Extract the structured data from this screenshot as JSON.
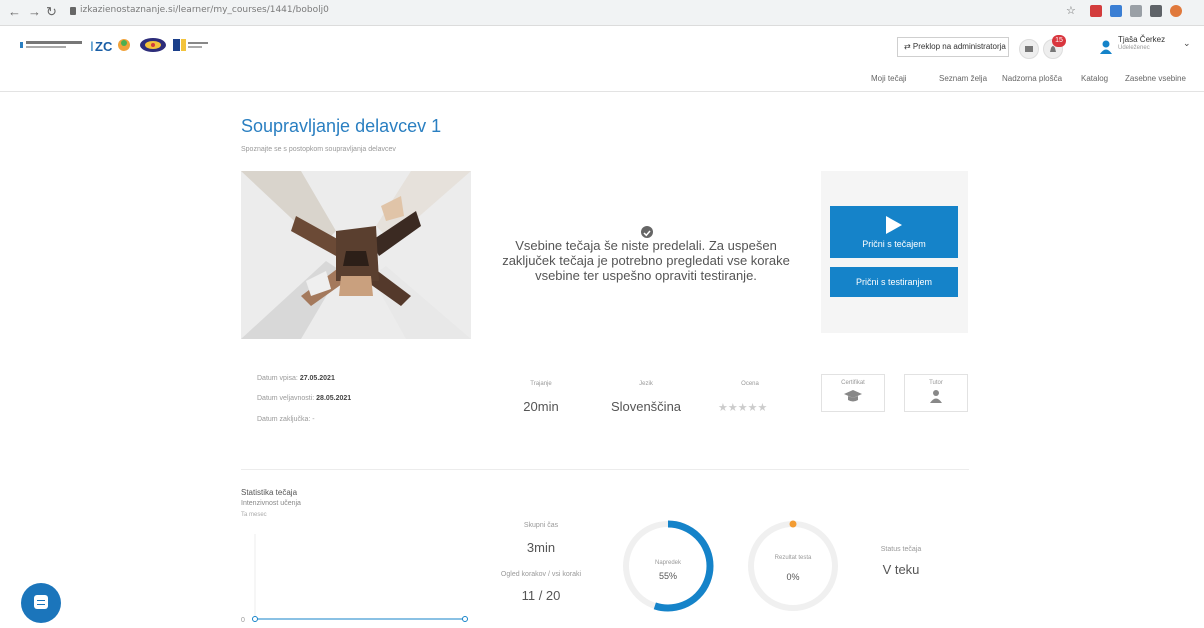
{
  "browser": {
    "url": "izkazienostaznanje.si/learner/my_courses/1441/bobolj0",
    "back_icon": "arrow-left-icon",
    "forward_icon": "arrow-right-icon",
    "reload_icon": "reload-icon"
  },
  "header": {
    "admin_button": "⇄ Preklop na administratorja",
    "notification_count": "15",
    "user_name": "Tjaša Čerkez",
    "user_role": "Udeleženec"
  },
  "menu": {
    "items": [
      "Moji tečaji",
      "Seznam želja",
      "Nadzorna plošča",
      "Katalog",
      "Zasebne vsebine"
    ]
  },
  "course": {
    "title": "Soupravljanje delavcev 1",
    "subtitle": "Spoznajte se s postopkom soupravljanja delavcev",
    "message": "Vsebine tečaja še niste predelali. Za uspešen zaključek tečaja je potrebno pregledati vse korake vsebine ter uspešno opraviti testiranje.",
    "start_button": "Prični s tečajem",
    "test_button": "Prični s testiranjem"
  },
  "dates": {
    "start_label": "Datum vpisa:",
    "start_value": "27.05.2021",
    "end_label": "Datum veljavnosti:",
    "end_value": "28.05.2021",
    "done_label": "Datum zaključka: -"
  },
  "info": {
    "duration_label": "Trajanje",
    "duration_value": "20min",
    "language_label": "Jezik",
    "language_value": "Slovenščina",
    "rating_label": "Ocena",
    "rating_stars": "★★★★★",
    "certificate_label": "Certifikat",
    "tutor_label": "Tutor"
  },
  "stats": {
    "title": "Statistika tečaja",
    "subtitle": "Intenzivnost učenja",
    "period": "Ta mesec",
    "chart_zero": "0",
    "total_time_label": "Skupni čas",
    "total_time_value": "3min",
    "steps_label": "Ogled korakov / vsi koraki",
    "steps_value": "11 / 20",
    "progress_label": "Napredek",
    "progress_value": "55%",
    "progress_fraction": 0.55,
    "test_label": "Rezultat testa",
    "test_value": "0%",
    "test_fraction": 0.0,
    "status_label": "Status tečaja",
    "status_value": "V teku"
  },
  "colors": {
    "accent": "#1583c9",
    "title_blue": "#2a7fc1",
    "orange": "#f39c33"
  }
}
